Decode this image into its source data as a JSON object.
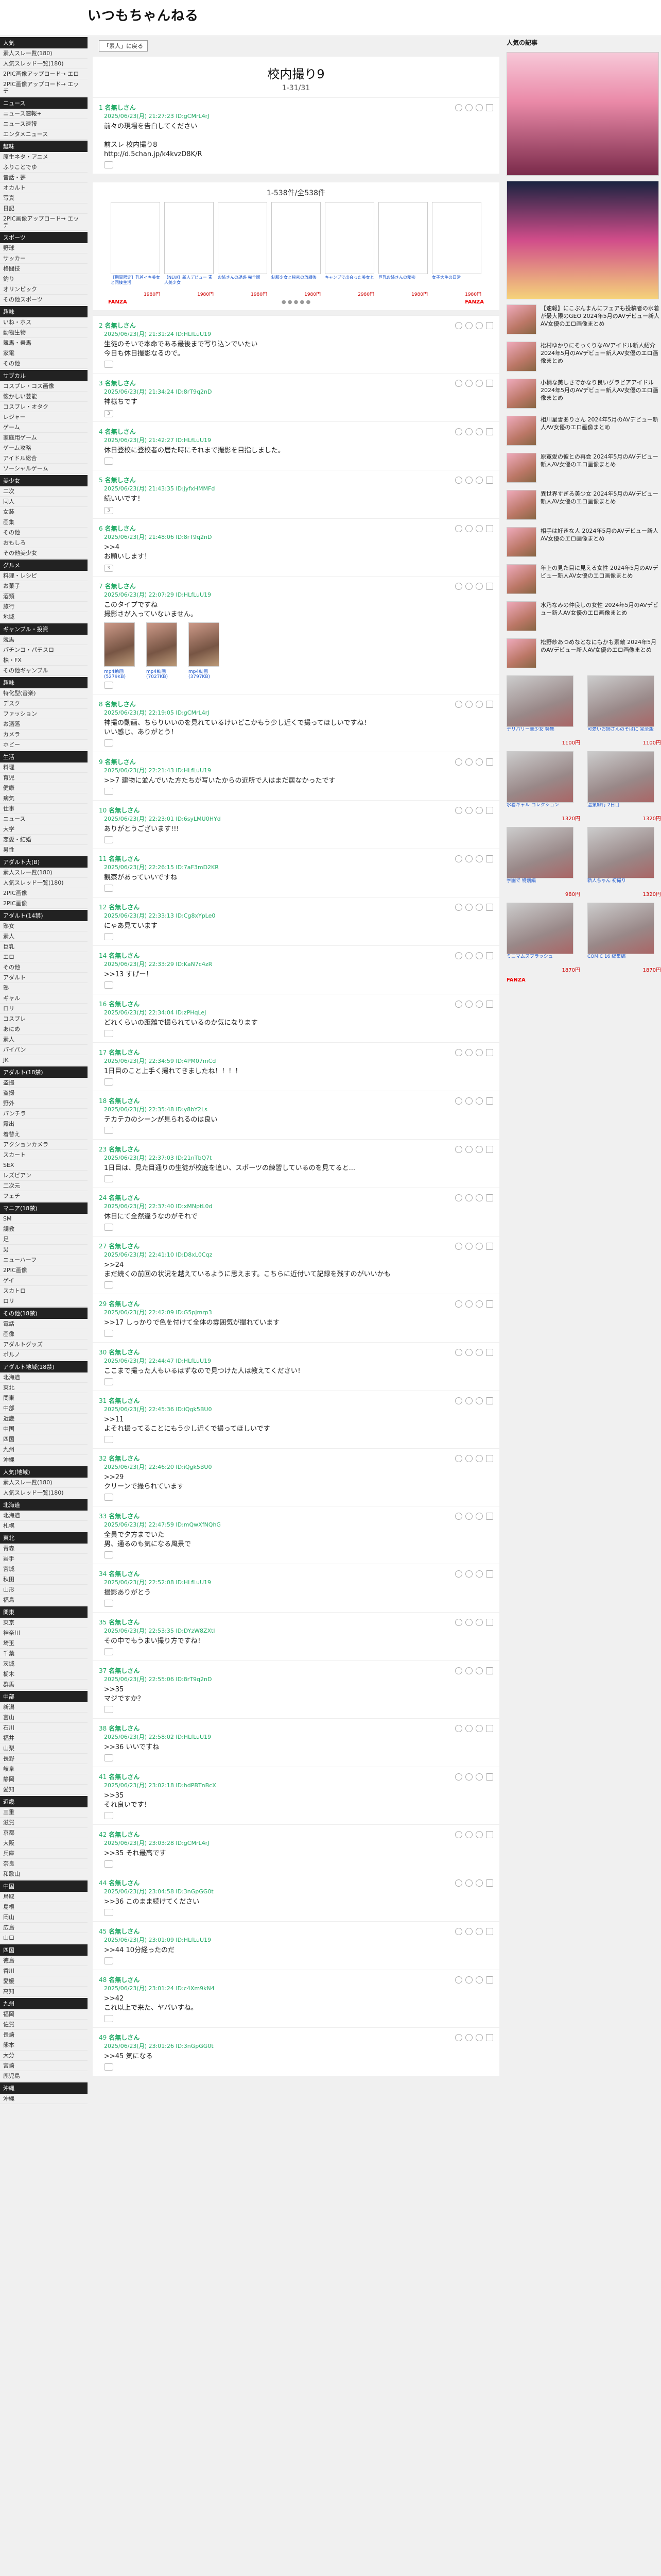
{
  "site": {
    "logo": "いつもちゃんねる"
  },
  "nav": {
    "back": "「素人」に戻る"
  },
  "thread": {
    "title": "校内撮り9",
    "range": "1-31/31"
  },
  "left_sidebar": [
    {
      "cat": "人気",
      "items": [
        "素人スレ一覧(180)",
        "人気スレッド一覧(180)",
        "2PIC画像アップロード→ エロ",
        "2PIC画像アップロード→ エッチ"
      ]
    },
    {
      "cat": "ニュース",
      "items": [
        "ニュース速報+",
        "ニュース速報",
        "エンタメニュース"
      ]
    },
    {
      "cat": "趣味",
      "items": [
        "原生ネタ・アニメ",
        "ふりことでゆ",
        "昔話・夢",
        "オカルト",
        "写真",
        "日記",
        "2PIC画像アップロード→ エッチ"
      ]
    },
    {
      "cat": "スポーツ",
      "items": [
        "野球",
        "サッカー",
        "格闘技",
        "釣り",
        "オリンピック",
        "その他スポーツ"
      ]
    },
    {
      "cat": "趣味",
      "items": [
        "いね・ホス",
        "動物生物",
        "競馬・乗馬",
        "家電",
        "その他"
      ]
    },
    {
      "cat": "サブカル",
      "items": [
        "コスプレ・コス画像",
        "懐かしい芸能",
        "コスプレ・オタク",
        "レジャー",
        "ゲーム",
        "家庭用ゲーム",
        "ゲーム攻略",
        "アイドル総合",
        "ソーシャルゲーム"
      ]
    },
    {
      "cat": "美少女",
      "items": [
        "二次",
        "同人",
        "女装",
        "画集",
        "その他",
        "おもしろ",
        "その他美少女"
      ]
    },
    {
      "cat": "グルメ",
      "items": [
        "料理・レシピ",
        "お菓子",
        "酒類",
        "旅行",
        "地域"
      ]
    },
    {
      "cat": "ギャンブル・投資",
      "items": [
        "競馬",
        "パチンコ・パチスロ",
        "株・FX",
        "その他ギャンブル"
      ]
    },
    {
      "cat": "趣味",
      "items": [
        "特化型(音楽)",
        "デスク",
        "ファッション",
        "お洒落",
        "カメラ",
        "ホビー"
      ]
    },
    {
      "cat": "生活",
      "items": [
        "料理",
        "育児",
        "健康",
        "病気",
        "仕事",
        "ニュース",
        "大学",
        "恋愛・結婚",
        "男性"
      ]
    },
    {
      "cat": "アダルト大(B)",
      "items": [
        "素人スレ一覧(180)",
        "人気スレッド一覧(180)",
        "2PIC画像",
        "2PIC画像"
      ]
    },
    {
      "cat": "アダルト(14禁)",
      "items": [
        "熟女",
        "素人",
        "巨乳",
        "エロ",
        "その他",
        "アダルト",
        "熟",
        "ギャル",
        "ロリ",
        "コスプレ",
        "あにめ",
        "素人",
        "パイパン",
        "JK"
      ]
    },
    {
      "cat": "アダルト(18禁)",
      "items": [
        "盗撮",
        "盗撮",
        "野外",
        "パンチラ",
        "露出",
        "着替え",
        "アクションカメラ",
        "スカート",
        "SEX",
        "レズビアン",
        "二次元",
        "フェチ"
      ]
    },
    {
      "cat": "マニア(18禁)",
      "items": [
        "SM",
        "調教",
        "足",
        "男",
        "ニューハーフ",
        "2PIC画像",
        "ゲイ",
        "スカトロ",
        "ロリ"
      ]
    },
    {
      "cat": "その他(18禁)",
      "items": [
        "電話",
        "画像",
        "アダルトグッズ",
        "ポルノ"
      ]
    },
    {
      "cat": "アダルト地域(18禁)",
      "items": [
        "北海道",
        "東北",
        "関東",
        "中部",
        "近畿",
        "中国",
        "四国",
        "九州",
        "沖縄"
      ]
    },
    {
      "cat": "人気(地域)",
      "items": [
        "素人スレ一覧(180)",
        "人気スレッド一覧(180)"
      ]
    },
    {
      "cat": "北海道",
      "items": [
        "北海道",
        "札幌"
      ]
    },
    {
      "cat": "東北",
      "items": [
        "青森",
        "岩手",
        "宮城",
        "秋田",
        "山形",
        "福島"
      ]
    },
    {
      "cat": "関東",
      "items": [
        "東京",
        "神奈川",
        "埼玉",
        "千葉",
        "茨城",
        "栃木",
        "群馬"
      ]
    },
    {
      "cat": "中部",
      "items": [
        "新潟",
        "富山",
        "石川",
        "福井",
        "山梨",
        "長野",
        "岐阜",
        "静岡",
        "愛知"
      ]
    },
    {
      "cat": "近畿",
      "items": [
        "三重",
        "滋賀",
        "京都",
        "大阪",
        "兵庫",
        "奈良",
        "和歌山"
      ]
    },
    {
      "cat": "中国",
      "items": [
        "鳥取",
        "島根",
        "岡山",
        "広島",
        "山口"
      ]
    },
    {
      "cat": "四国",
      "items": [
        "徳島",
        "香川",
        "愛媛",
        "高知"
      ]
    },
    {
      "cat": "九州",
      "items": [
        "福岡",
        "佐賀",
        "長崎",
        "熊本",
        "大分",
        "宮崎",
        "鹿児島"
      ]
    },
    {
      "cat": "沖縄",
      "items": [
        "沖縄"
      ]
    }
  ],
  "ad_block": {
    "caption": "1-538件/全538件",
    "items": [
      {
        "text": "【期間限定】乳首イキ美女と同棲生活",
        "price": "1980円"
      },
      {
        "text": "【NEW】新人デビュー 素人美少女",
        "price": "1980円"
      },
      {
        "text": "お姉さんの誘惑 完全版",
        "price": "1980円"
      },
      {
        "text": "制服少女と秘密の放課後",
        "price": "1980円"
      },
      {
        "text": "キャンプで出会った美女と",
        "price": "2980円"
      },
      {
        "text": "巨乳お姉さんの秘密",
        "price": "1980円"
      },
      {
        "text": "女子大生の日常",
        "price": "1980円"
      }
    ],
    "brand": "FANZA"
  },
  "posts": [
    {
      "num": "1",
      "name": "名無しさん",
      "date": "2025/06/23(月) 21:27:23 ID:gCMrL4rJ",
      "body": "前々の現場を告白してください\n\n前スレ 校内撮り8\nhttp://d.5chan.jp/k4kvzD8K/R",
      "likes": ""
    },
    {
      "num": "2",
      "name": "名無しさん",
      "date": "2025/06/23(月) 21:31:24 ID:HLfLuU19",
      "body": "生徒のそいで本命である最後まで写り込ンでいたい\n今日も休日撮影なるので。",
      "likes": ""
    },
    {
      "num": "3",
      "name": "名無しさん",
      "date": "2025/06/23(月) 21:34:24 ID:8rT9q2nD",
      "body": "神様ちです",
      "likes": "3"
    },
    {
      "num": "4",
      "name": "名無しさん",
      "date": "2025/06/23(月) 21:42:27 ID:HLfLuU19",
      "body": "休日登校に登校者の居た時にそれまで撮影を目指しました。",
      "likes": ""
    },
    {
      "num": "5",
      "name": "名無しさん",
      "date": "2025/06/23(月) 21:43:35 ID:jyfxHMMFd",
      "body": "続いいです！",
      "likes": "3"
    },
    {
      "num": "6",
      "name": "名無しさん",
      "date": "2025/06/23(月) 21:48:06 ID:8rT9q2nD",
      "body": ">>4\nお願いします！",
      "likes": "3"
    },
    {
      "num": "7",
      "name": "名無しさん",
      "date": "2025/06/23(月) 22:07:29 ID:HLfLuU19",
      "body": "このタイプですね\n撮影さが入っていないません。",
      "likes": "",
      "thumbs": [
        "mp4動画(5279KB)",
        "mp4動画(7027KB)",
        "mp4動画(3797KB)"
      ]
    },
    {
      "num": "8",
      "name": "名無しさん",
      "date": "2025/06/23(月) 22:19:05 ID:gCMrL4rJ",
      "body": "神撮の動画、ちらりいいのを見れているけいどこかもう少し近くで撮ってほしいですね！\nいい感じ、ありがとう！",
      "likes": ""
    },
    {
      "num": "9",
      "name": "名無しさん",
      "date": "2025/06/23(月) 22:21:43 ID:HLfLuU19",
      "body": ">>7 建物に並んでいた方たちが写いたからの近所で人はまだ居なかったです",
      "likes": ""
    },
    {
      "num": "10",
      "name": "名無しさん",
      "date": "2025/06/23(月) 22:23:01 ID:6syLMU0HYd",
      "body": "ありがとうございます!!!",
      "likes": ""
    },
    {
      "num": "11",
      "name": "名無しさん",
      "date": "2025/06/23(月) 22:26:15 ID:7aF3mD2KR",
      "body": "観察があっていいですね",
      "likes": ""
    },
    {
      "num": "12",
      "name": "名無しさん",
      "date": "2025/06/23(月) 22:33:13 ID:Cg8xYpLe0",
      "body": "にゃあ見ています",
      "likes": ""
    },
    {
      "num": "14",
      "name": "名無しさん",
      "date": "2025/06/23(月) 22:33:29 ID:KaN7c4zR",
      "body": ">>13 すげー！",
      "likes": ""
    },
    {
      "num": "16",
      "name": "名無しさん",
      "date": "2025/06/23(月) 22:34:04 ID:zPHqLeJ",
      "body": "どれくらいの距離で撮られているのか気になります",
      "likes": ""
    },
    {
      "num": "17",
      "name": "名無しさん",
      "date": "2025/06/23(月) 22:34:59 ID:4PM07mCd",
      "body": "1日目のこと上手く撮れてきましたね！！！！",
      "likes": ""
    },
    {
      "num": "18",
      "name": "名無しさん",
      "date": "2025/06/23(月) 22:35:48 ID:y8bY2Ls",
      "body": "テカテカのシーンが見られるのは良い",
      "likes": ""
    },
    {
      "num": "23",
      "name": "名無しさん",
      "date": "2025/06/23(月) 22:37:03 ID:21nTbQ7t",
      "body": "1日目は、見た目通りの生徒が校庭を追い、スポーツの練習しているのを見てると...",
      "likes": ""
    },
    {
      "num": "24",
      "name": "名無しさん",
      "date": "2025/06/23(月) 22:37:40 ID:xMNptL0d",
      "body": "休日にて全然違うなのがそれで",
      "likes": ""
    },
    {
      "num": "27",
      "name": "名無しさん",
      "date": "2025/06/23(月) 22:41:10 ID:D8xL0Cqz",
      "body": ">>24\nまだ続くの前回の状況を越えているように思えます。こちらに近付いて記録を残すのがいいかも",
      "likes": ""
    },
    {
      "num": "29",
      "name": "名無しさん",
      "date": "2025/06/23(月) 22:42:09 ID:G5pJmrp3",
      "body": ">>17 しっかりで色を付けて全体の雰囲気が撮れています",
      "likes": ""
    },
    {
      "num": "30",
      "name": "名無しさん",
      "date": "2025/06/23(月) 22:44:47 ID:HLfLuU19",
      "body": "ここまで撮った人もいるはずなので見つけた人は教えてください！",
      "likes": ""
    },
    {
      "num": "31",
      "name": "名無しさん",
      "date": "2025/06/23(月) 22:45:36 ID:iQgk5BU0",
      "body": ">>11\nよそれ撮ってることにもう少し近くで撮ってほしいです",
      "likes": ""
    },
    {
      "num": "32",
      "name": "名無しさん",
      "date": "2025/06/23(月) 22:46:20 ID:iQgk5BU0",
      "body": ">>29\nクリーンで撮られています",
      "likes": ""
    },
    {
      "num": "33",
      "name": "名無しさん",
      "date": "2025/06/23(月) 22:47:59 ID:mQwXfNQhG",
      "body": "全員で夕方までいた\n男、通るのも気になる風景で",
      "likes": ""
    },
    {
      "num": "34",
      "name": "名無しさん",
      "date": "2025/06/23(月) 22:52:08 ID:HLfLuU19",
      "body": "撮影ありがとう",
      "likes": ""
    },
    {
      "num": "35",
      "name": "名無しさん",
      "date": "2025/06/23(月) 22:53:35 ID:DYzW8ZXtl",
      "body": "その中でもうまい撮り方ですね！",
      "likes": ""
    },
    {
      "num": "37",
      "name": "名無しさん",
      "date": "2025/06/23(月) 22:55:06 ID:8rT9q2nD",
      "body": ">>35\nマジですか？",
      "likes": ""
    },
    {
      "num": "38",
      "name": "名無しさん",
      "date": "2025/06/23(月) 22:58:02 ID:HLfLuU19",
      "body": ">>36 いいですね",
      "likes": ""
    },
    {
      "num": "41",
      "name": "名無しさん",
      "date": "2025/06/23(月) 23:02:18 ID:hdPBTnBcX",
      "body": ">>35\nそれ良いです！",
      "likes": ""
    },
    {
      "num": "42",
      "name": "名無しさん",
      "date": "2025/06/23(月) 23:03:28 ID:gCMrL4rJ",
      "body": ">>35 それ最高です",
      "likes": ""
    },
    {
      "num": "44",
      "name": "名無しさん",
      "date": "2025/06/23(月) 23:04:58 ID:3nGpGG0t",
      "body": ">>36 このまま続けてください",
      "likes": ""
    },
    {
      "num": "45",
      "name": "名無しさん",
      "date": "2025/06/23(月) 23:01:09 ID:HLfLuU19",
      "body": ">>44 10分経ったのだ",
      "likes": ""
    },
    {
      "num": "48",
      "name": "名無しさん",
      "date": "2025/06/23(月) 23:01:24 ID:c4Xm9kN4",
      "body": ">>42\nこれ以上で来た、ヤバいすね。",
      "likes": ""
    },
    {
      "num": "49",
      "name": "名無しさん",
      "date": "2025/06/23(月) 23:01:26 ID:3nGpGG0t",
      "body": ">>45 気になる",
      "likes": ""
    }
  ],
  "right_sidebar": {
    "section": "人気の記事",
    "ranking": [
      "【速報】にこぷんまんにフェアも投稿者の水着が最大限のGEO 2024年5月のAVデビュー新人AV女優のエロ画像まとめ",
      "松村ゆかりにそっくりなAVアイドル新人紹介 2024年5月のAVデビュー新人AV女優のエロ画像まとめ",
      "小柄な美しさでかなり良いグラビアアイドル 2024年5月のAVデビュー新人AV女優のエロ画像まとめ",
      "相川星雪ありさん 2024年5月のAVデビュー新人AV女優のエロ画像まとめ",
      "原寛愛の彼との再会 2024年5月のAVデビュー新人AV女優のエロ画像まとめ",
      "異世界すぎる美少女 2024年5月のAVデビュー新人AV女優のエロ画像まとめ",
      "相手は好きな人 2024年5月のAVデビュー新人AV女優のエロ画像まとめ",
      "年上の見た目に見える女性 2024年5月のAVデビュー新人AV女優のエロ画像まとめ",
      "水乃なみの仲良しの女性 2024年5月のAVデビュー新人AV女優のエロ画像まとめ",
      "松野紗あつめなとなにもかも素敵 2024年5月のAVデビュー新人AV女優のエロ画像まとめ"
    ],
    "grid_ads": [
      {
        "text": "デリバリー美少女 特集",
        "old": "",
        "price": "1100円"
      },
      {
        "text": "可愛いお姉さんのそばに 完全版",
        "old": "",
        "price": "1100円"
      },
      {
        "text": "水着ギャル コレクション",
        "old": "",
        "price": "1320円"
      },
      {
        "text": "温泉旅行 2日目",
        "old": "",
        "price": "1320円"
      },
      {
        "text": "学園で 特別編",
        "old": "",
        "price": "980円"
      },
      {
        "text": "新人ちゃん 初撮り",
        "old": "",
        "price": "1320円"
      },
      {
        "text": "ミニマムスプラッシュ",
        "old": "",
        "price": "1870円"
      },
      {
        "text": "COMIC 16 総集編",
        "old": "",
        "price": "1870円"
      }
    ],
    "brand": "FANZA"
  }
}
